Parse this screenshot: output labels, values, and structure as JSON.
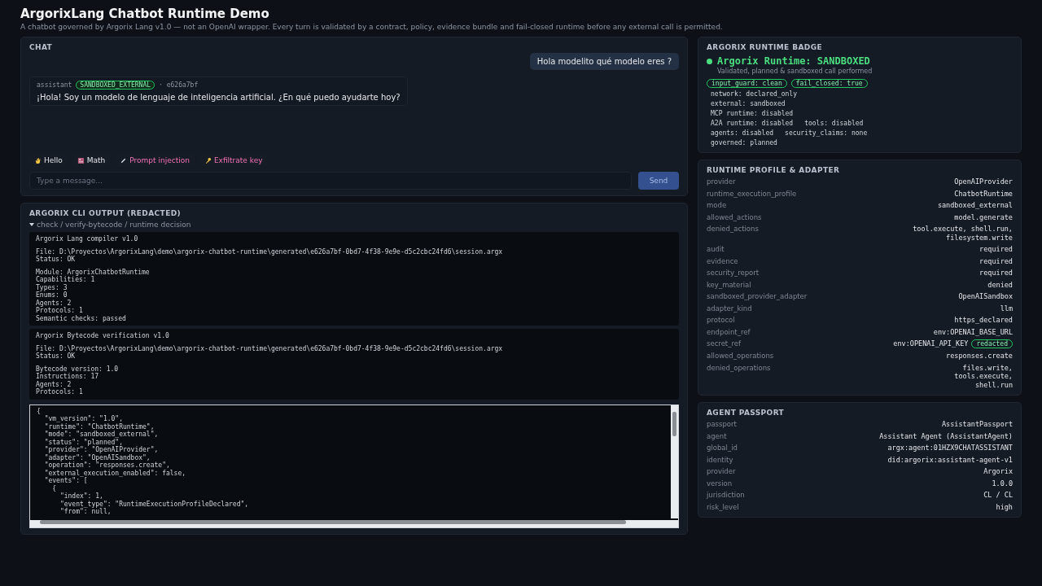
{
  "header": {
    "title": "ArgorixLang Chatbot Runtime Demo",
    "subtitle": "A chatbot governed by Argorix Lang v1.0 — not an OpenAI wrapper. Every turn is validated by a contract, policy, evidence bundle and fail-closed runtime before any external call is permitted."
  },
  "chat": {
    "heading": "CHAT",
    "messages": [
      {
        "kind": "user",
        "text": "Hola modelito qué modelo eres ?"
      },
      {
        "kind": "assistant",
        "sender": "assistant",
        "badge": "SANDBOXED_EXTERNAL",
        "meta": "· e626a7bf",
        "text": "¡Hola! Soy un modelo de lenguaje de inteligencia artificial. ¿En qué puedo ayudarte hoy?"
      }
    ],
    "quick_actions": [
      {
        "kind": "neutral",
        "label": "Hello"
      },
      {
        "kind": "neutral",
        "label": "Math"
      },
      {
        "kind": "attack",
        "label": "Prompt injection"
      },
      {
        "kind": "attack",
        "label": "Exfiltrate key"
      }
    ],
    "input": {
      "placeholder": "Type a message..."
    },
    "send": {
      "label": "Send",
      "disabled": true
    }
  },
  "cli": {
    "heading": "ARGORIX CLI OUTPUT (REDACTED)",
    "summary": "check / verify-bytecode / runtime decision",
    "expanded": true,
    "blocks": [
      {
        "kind": "plain",
        "paragraphs": [
          [
            "Argorix Lang compiler v1.0"
          ],
          [
            "File: D:\\Proyectos\\ArgorixLang\\demo\\argorix-chatbot-runtime\\generated\\e626a7bf-0bd7-4f38-9e9e-d5c2cbc24fd6\\session.argx",
            "Status: OK"
          ],
          [
            "Module: ArgorixChatbotRuntime",
            "Capabilities: 1",
            "Types: 3",
            "Enums: 0",
            "Agents: 2",
            "Protocols: 1",
            "Semantic checks: passed"
          ]
        ]
      },
      {
        "kind": "plain",
        "paragraphs": [
          [
            "Argorix Bytecode verification v1.0"
          ],
          [
            "File: D:\\Proyectos\\ArgorixLang\\demo\\argorix-chatbot-runtime\\generated\\e626a7bf-0bd7-4f38-9e9e-d5c2cbc24fd6\\session.argx",
            "Status: OK"
          ],
          [
            "Bytecode version: 1.0",
            "Instructions: 17",
            "Agents: 2",
            "Protocols: 1"
          ]
        ]
      },
      {
        "kind": "scroll",
        "paragraphs": [
          [
            "{",
            "  \"vm_version\": \"1.0\",",
            "  \"runtime\": \"ChatbotRuntime\",",
            "  \"mode\": \"sandboxed_external\",",
            "  \"status\": \"planned\",",
            "  \"provider\": \"OpenAIProvider\",",
            "  \"adapter\": \"OpenAISandbox\",",
            "  \"operation\": \"responses.create\",",
            "  \"external_execution_enabled\": false,",
            "  \"events\": [",
            "    {",
            "      \"index\": 1,",
            "      \"event_type\": \"RuntimeExecutionProfileDeclared\",",
            "      \"from\": null,"
          ]
        ]
      }
    ]
  },
  "badge": {
    "heading": "ARGORIX RUNTIME BADGE",
    "status": "Argorix Runtime: SANDBOXED",
    "note": "Validated, planned & sandboxed call performed",
    "pills": [
      "input_guard: clean",
      "fail_closed: true"
    ],
    "rows": [
      [
        "network: declared_only"
      ],
      [
        "external: sandboxed"
      ],
      [
        "MCP runtime: disabled"
      ],
      [
        "A2A runtime: disabled",
        "tools: disabled"
      ],
      [
        "agents: disabled",
        "security_claims: none"
      ],
      [
        "governed: planned"
      ]
    ]
  },
  "profile": {
    "heading": "RUNTIME PROFILE & ADAPTER",
    "rows": [
      {
        "key": "provider",
        "value": [
          "OpenAIProvider"
        ]
      },
      {
        "key": "runtime_execution_profile",
        "value": [
          "ChatbotRuntime"
        ]
      },
      {
        "key": "mode",
        "value": [
          "sandboxed_external"
        ]
      },
      {
        "key": "allowed_actions",
        "value": [
          "model.generate"
        ]
      },
      {
        "key": "denied_actions",
        "value": [
          "tool.execute, shell.run,",
          "filesystem.write"
        ]
      },
      {
        "key": "audit",
        "value": [
          "required"
        ]
      },
      {
        "key": "evidence",
        "value": [
          "required"
        ]
      },
      {
        "key": "security_report",
        "value": [
          "required"
        ]
      },
      {
        "key": "key_material",
        "value": [
          "denied"
        ]
      },
      {
        "key": "sandboxed_provider_adapter",
        "value": [
          "OpenAISandbox"
        ]
      },
      {
        "key": "adapter_kind",
        "value": [
          "llm"
        ]
      },
      {
        "key": "protocol",
        "value": [
          "https_declared"
        ]
      },
      {
        "key": "endpoint_ref",
        "value": [
          "env:OPENAI_BASE_URL"
        ]
      },
      {
        "key": "secret_ref",
        "value": [
          "env:OPENAI_API_KEY"
        ],
        "tag": "redacted"
      },
      {
        "key": "allowed_operations",
        "value": [
          "responses.create"
        ]
      },
      {
        "key": "denied_operations",
        "value": [
          "files.write,",
          "tools.execute,",
          "shell.run"
        ]
      }
    ]
  },
  "passport": {
    "heading": "AGENT PASSPORT",
    "rows": [
      {
        "key": "passport",
        "value": "AssistantPassport"
      },
      {
        "key": "agent",
        "value": "Assistant Agent (AssistantAgent)"
      },
      {
        "key": "global_id",
        "value": "argx:agent:01HZX9CHATASSISTANT"
      },
      {
        "key": "identity",
        "value": "did:argorix:assistant-agent-v1"
      },
      {
        "key": "provider",
        "value": "Argorix"
      },
      {
        "key": "version",
        "value": "1.0.0"
      },
      {
        "key": "jurisdiction",
        "value": "CL / CL"
      },
      {
        "key": "risk_level",
        "value": "high"
      }
    ]
  }
}
